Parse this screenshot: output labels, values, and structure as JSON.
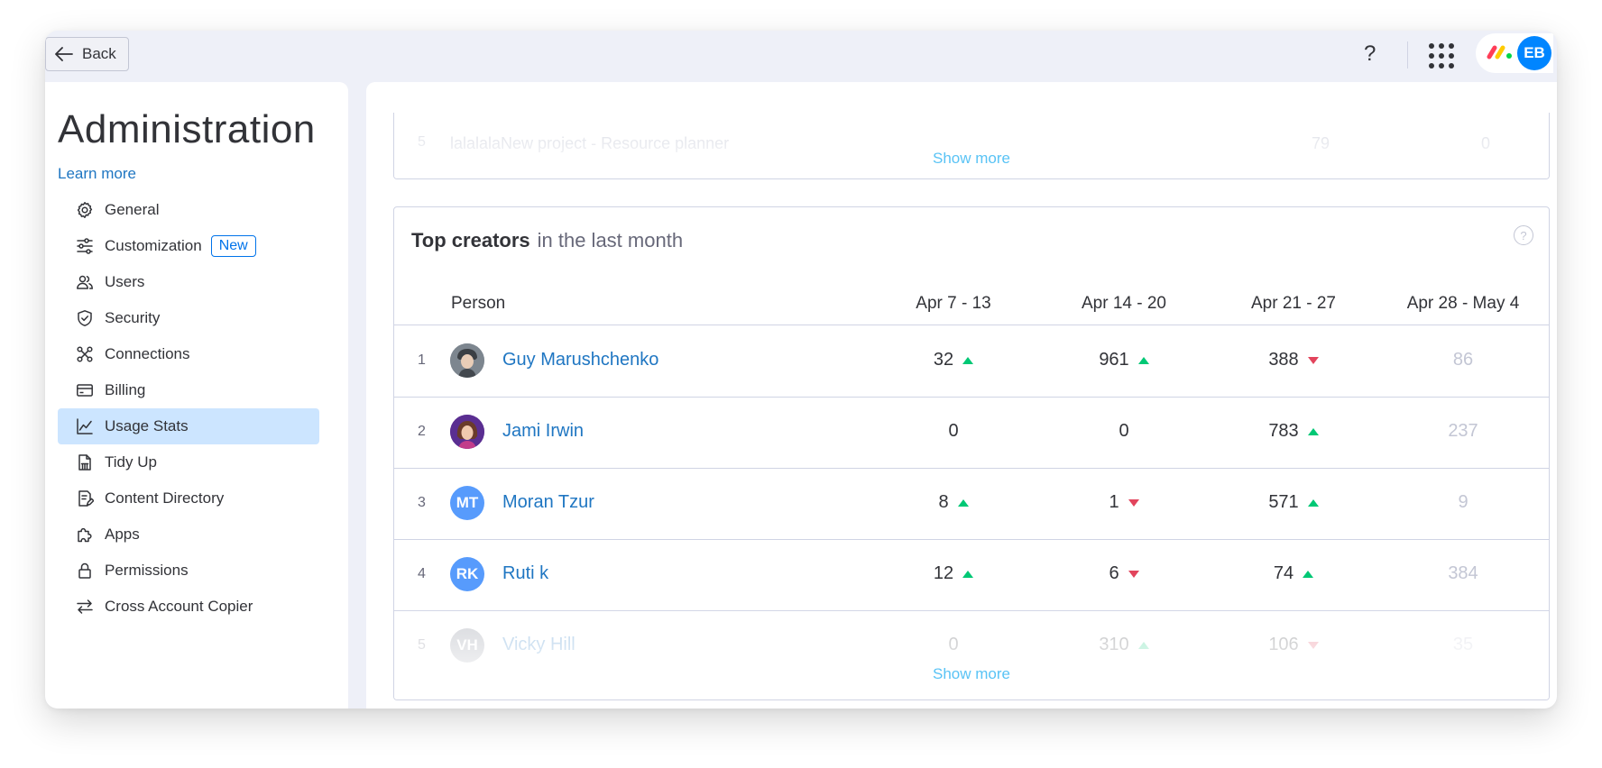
{
  "topbar": {
    "back_label": "Back",
    "help_glyph": "?",
    "user_initials": "EB"
  },
  "sidebar": {
    "title": "Administration",
    "learn_more": "Learn more",
    "items": [
      {
        "label": "General",
        "icon": "gear-icon"
      },
      {
        "label": "Customization",
        "icon": "sliders-icon",
        "badge": "New"
      },
      {
        "label": "Users",
        "icon": "users-icon"
      },
      {
        "label": "Security",
        "icon": "shield-icon"
      },
      {
        "label": "Connections",
        "icon": "connections-icon"
      },
      {
        "label": "Billing",
        "icon": "credit-card-icon"
      },
      {
        "label": "Usage Stats",
        "icon": "line-chart-icon",
        "active": true
      },
      {
        "label": "Tidy Up",
        "icon": "broom-icon"
      },
      {
        "label": "Content Directory",
        "icon": "document-icon"
      },
      {
        "label": "Apps",
        "icon": "puzzle-icon"
      },
      {
        "label": "Permissions",
        "icon": "lock-icon"
      },
      {
        "label": "Cross Account Copier",
        "icon": "swap-arrows-icon"
      }
    ]
  },
  "previous_card": {
    "partial_row": {
      "rank": "5",
      "name": "lalalalaNew project - Resource planner",
      "col3": "79",
      "col4": "0"
    },
    "show_more": "Show more"
  },
  "top_creators": {
    "title": "Top creators",
    "subtitle": "in the last month",
    "info_glyph": "?",
    "columns": [
      "Person",
      "Apr 7 - 13",
      "Apr 14 - 20",
      "Apr 21 - 27",
      "Apr 28 - May 4"
    ],
    "rows": [
      {
        "rank": "1",
        "name": "Guy Marushchenko",
        "avatar": "photo",
        "values": [
          "32",
          "961",
          "388",
          "86"
        ],
        "trends": [
          "up",
          "up",
          "down",
          ""
        ]
      },
      {
        "rank": "2",
        "name": "Jami Irwin",
        "avatar": "photo",
        "values": [
          "0",
          "0",
          "783",
          "237"
        ],
        "trends": [
          "",
          "",
          "up",
          ""
        ]
      },
      {
        "rank": "3",
        "name": "Moran Tzur",
        "initials": "MT",
        "values": [
          "8",
          "1",
          "571",
          "9"
        ],
        "trends": [
          "up",
          "down",
          "up",
          ""
        ]
      },
      {
        "rank": "4",
        "name": "Ruti k",
        "initials": "RK",
        "values": [
          "12",
          "6",
          "74",
          "384"
        ],
        "trends": [
          "up",
          "down",
          "up",
          ""
        ]
      },
      {
        "rank": "5",
        "name": "Vicky Hill",
        "initials": "VH",
        "values": [
          "0",
          "310",
          "106",
          "35"
        ],
        "trends": [
          "",
          "up",
          "down",
          ""
        ]
      }
    ],
    "show_more": "Show more"
  },
  "colors": {
    "accent": "#0073ea",
    "link": "#1f76c2",
    "active_nav": "#cce5ff",
    "trend_up": "#00c875",
    "trend_down": "#e2445c",
    "avatar_initials_bg": "#579bfc"
  }
}
